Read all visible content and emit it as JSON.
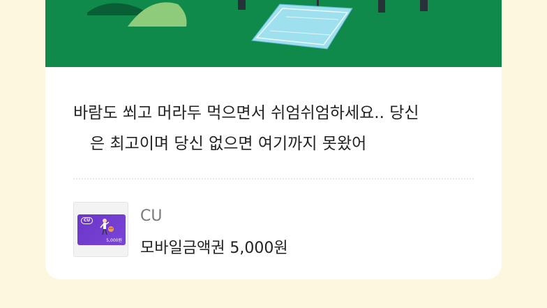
{
  "message": {
    "line1": "바람도 쐬고 머라두 먹으면서 쉬엄쉬엄하세요.. 당신",
    "line2": "은 최고이며 당신 없으면 여기까지 못왔어"
  },
  "product": {
    "brand": "CU",
    "name": "모바일금액권 5,000원",
    "thumbnail": {
      "logo_text": "CU",
      "amount_text": "5,000원"
    }
  },
  "colors": {
    "background": "#fdf7df",
    "card": "#ffffff",
    "illustration_green": "#0f8a4a",
    "giftcard_purple": "#6a36c8"
  },
  "icons": {
    "illustration": "picnic-park-illustration",
    "thumbnail": "cu-giftcard-thumbnail"
  }
}
